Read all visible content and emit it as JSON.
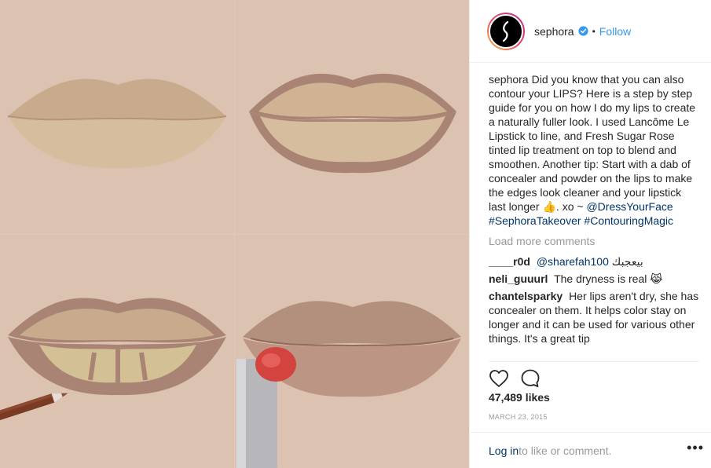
{
  "photo": {
    "alt_name": "lip contour tutorial collage"
  },
  "header": {
    "username": "sephora",
    "dot": "•",
    "follow_label": "Follow",
    "verified_icon": "verified-badge-icon"
  },
  "caption": {
    "username": "sephora",
    "text": "Did you know that you can also contour your LIPS? Here is a step by step guide for you on how I do my lips to create a naturally fuller look. I used Lancôme Le Lipstick to line, and Fresh Sugar Rose tinted lip treatment on top to blend and smoothen. Another tip: Start with a dab of concealer and powder on the lips to make the edges look cleaner and your lipstick last longer",
    "emoji": "👍",
    "tail": ". xo ~",
    "mention": "@DressYourFace",
    "tag1": "#SephoraTakeover",
    "tag2": "#ContouringMagic"
  },
  "load_more": "Load more comments",
  "comments": [
    {
      "username": "____r0d",
      "mention": "@sharefah100",
      "text": "بيعجبك"
    },
    {
      "username": "neli_guuurl",
      "text": "The dryness is real",
      "emoji": "😹"
    },
    {
      "username": "chantelsparky",
      "text": "Her lips aren't dry, she has concealer on them. It helps color stay on longer and it can be used for various other things. It's a great tip"
    }
  ],
  "actions": {
    "like_icon": "heart-icon",
    "comment_icon": "comment-bubble-icon"
  },
  "likes": "47,489 likes",
  "date": "MARCH 23, 2015",
  "footer": {
    "login": "Log in",
    "rest": " to like or comment.",
    "more": "•••"
  },
  "colors": {
    "accent": "#3897f0",
    "link": "#003569",
    "muted": "#999999"
  }
}
